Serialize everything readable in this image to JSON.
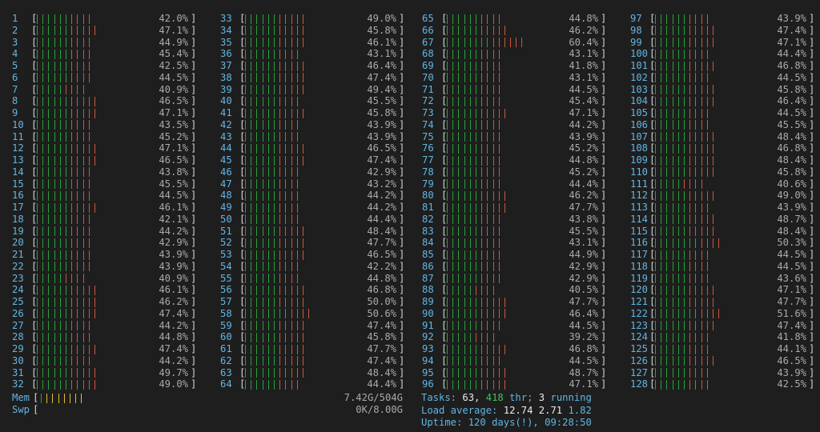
{
  "colors": {
    "background": "#1e1e1e",
    "label": "#61b5e3",
    "green": "#25a33c",
    "red": "#d2543b",
    "yellow": "#d9c236",
    "text": "#a9a9a9"
  },
  "cpus": [
    {
      "id": "1",
      "pct": "42.0%"
    },
    {
      "id": "2",
      "pct": "47.1%"
    },
    {
      "id": "3",
      "pct": "44.9%"
    },
    {
      "id": "4",
      "pct": "45.4%"
    },
    {
      "id": "5",
      "pct": "42.5%"
    },
    {
      "id": "6",
      "pct": "44.5%"
    },
    {
      "id": "7",
      "pct": "40.9%"
    },
    {
      "id": "8",
      "pct": "46.5%"
    },
    {
      "id": "9",
      "pct": "47.1%"
    },
    {
      "id": "10",
      "pct": "43.5%"
    },
    {
      "id": "11",
      "pct": "45.2%"
    },
    {
      "id": "12",
      "pct": "47.1%"
    },
    {
      "id": "13",
      "pct": "46.5%"
    },
    {
      "id": "14",
      "pct": "43.8%"
    },
    {
      "id": "15",
      "pct": "45.5%"
    },
    {
      "id": "16",
      "pct": "44.5%"
    },
    {
      "id": "17",
      "pct": "46.1%"
    },
    {
      "id": "18",
      "pct": "42.1%"
    },
    {
      "id": "19",
      "pct": "44.2%"
    },
    {
      "id": "20",
      "pct": "42.9%"
    },
    {
      "id": "21",
      "pct": "43.9%"
    },
    {
      "id": "22",
      "pct": "43.9%"
    },
    {
      "id": "23",
      "pct": "40.9%"
    },
    {
      "id": "24",
      "pct": "46.1%"
    },
    {
      "id": "25",
      "pct": "46.2%"
    },
    {
      "id": "26",
      "pct": "47.4%"
    },
    {
      "id": "27",
      "pct": "44.2%"
    },
    {
      "id": "28",
      "pct": "44.8%"
    },
    {
      "id": "29",
      "pct": "47.4%"
    },
    {
      "id": "30",
      "pct": "44.2%"
    },
    {
      "id": "31",
      "pct": "49.7%"
    },
    {
      "id": "32",
      "pct": "49.0%"
    },
    {
      "id": "33",
      "pct": "49.0%"
    },
    {
      "id": "34",
      "pct": "45.8%"
    },
    {
      "id": "35",
      "pct": "46.1%"
    },
    {
      "id": "36",
      "pct": "43.1%"
    },
    {
      "id": "37",
      "pct": "46.4%"
    },
    {
      "id": "38",
      "pct": "47.4%"
    },
    {
      "id": "39",
      "pct": "49.4%"
    },
    {
      "id": "40",
      "pct": "45.5%"
    },
    {
      "id": "41",
      "pct": "45.8%"
    },
    {
      "id": "42",
      "pct": "43.9%"
    },
    {
      "id": "43",
      "pct": "43.9%"
    },
    {
      "id": "44",
      "pct": "46.5%"
    },
    {
      "id": "45",
      "pct": "47.4%"
    },
    {
      "id": "46",
      "pct": "42.9%"
    },
    {
      "id": "47",
      "pct": "43.2%"
    },
    {
      "id": "48",
      "pct": "44.2%"
    },
    {
      "id": "49",
      "pct": "44.2%"
    },
    {
      "id": "50",
      "pct": "44.4%"
    },
    {
      "id": "51",
      "pct": "48.4%"
    },
    {
      "id": "52",
      "pct": "47.7%"
    },
    {
      "id": "53",
      "pct": "46.5%"
    },
    {
      "id": "54",
      "pct": "42.2%"
    },
    {
      "id": "55",
      "pct": "44.8%"
    },
    {
      "id": "56",
      "pct": "46.8%"
    },
    {
      "id": "57",
      "pct": "50.0%"
    },
    {
      "id": "58",
      "pct": "50.6%"
    },
    {
      "id": "59",
      "pct": "47.4%"
    },
    {
      "id": "60",
      "pct": "45.8%"
    },
    {
      "id": "61",
      "pct": "47.7%"
    },
    {
      "id": "62",
      "pct": "47.4%"
    },
    {
      "id": "63",
      "pct": "48.4%"
    },
    {
      "id": "64",
      "pct": "44.4%"
    },
    {
      "id": "65",
      "pct": "44.8%"
    },
    {
      "id": "66",
      "pct": "46.2%"
    },
    {
      "id": "67",
      "pct": "60.4%"
    },
    {
      "id": "68",
      "pct": "43.1%"
    },
    {
      "id": "69",
      "pct": "41.8%"
    },
    {
      "id": "70",
      "pct": "43.1%"
    },
    {
      "id": "71",
      "pct": "44.5%"
    },
    {
      "id": "72",
      "pct": "45.4%"
    },
    {
      "id": "73",
      "pct": "47.1%"
    },
    {
      "id": "74",
      "pct": "44.2%"
    },
    {
      "id": "75",
      "pct": "43.9%"
    },
    {
      "id": "76",
      "pct": "45.2%"
    },
    {
      "id": "77",
      "pct": "44.8%"
    },
    {
      "id": "78",
      "pct": "45.2%"
    },
    {
      "id": "79",
      "pct": "44.4%"
    },
    {
      "id": "80",
      "pct": "46.2%"
    },
    {
      "id": "81",
      "pct": "47.7%"
    },
    {
      "id": "82",
      "pct": "43.8%"
    },
    {
      "id": "83",
      "pct": "45.5%"
    },
    {
      "id": "84",
      "pct": "43.1%"
    },
    {
      "id": "85",
      "pct": "44.9%"
    },
    {
      "id": "86",
      "pct": "42.9%"
    },
    {
      "id": "87",
      "pct": "42.9%"
    },
    {
      "id": "88",
      "pct": "40.5%"
    },
    {
      "id": "89",
      "pct": "47.7%"
    },
    {
      "id": "90",
      "pct": "46.4%"
    },
    {
      "id": "91",
      "pct": "44.5%"
    },
    {
      "id": "92",
      "pct": "39.2%"
    },
    {
      "id": "93",
      "pct": "46.8%"
    },
    {
      "id": "94",
      "pct": "44.5%"
    },
    {
      "id": "95",
      "pct": "48.7%"
    },
    {
      "id": "96",
      "pct": "47.1%"
    },
    {
      "id": "97",
      "pct": "43.9%"
    },
    {
      "id": "98",
      "pct": "47.4%"
    },
    {
      "id": "99",
      "pct": "47.1%"
    },
    {
      "id": "100",
      "pct": "44.4%"
    },
    {
      "id": "101",
      "pct": "46.8%"
    },
    {
      "id": "102",
      "pct": "44.5%"
    },
    {
      "id": "103",
      "pct": "45.8%"
    },
    {
      "id": "104",
      "pct": "46.4%"
    },
    {
      "id": "105",
      "pct": "44.5%"
    },
    {
      "id": "106",
      "pct": "45.5%"
    },
    {
      "id": "107",
      "pct": "48.4%"
    },
    {
      "id": "108",
      "pct": "46.8%"
    },
    {
      "id": "109",
      "pct": "48.4%"
    },
    {
      "id": "110",
      "pct": "45.8%"
    },
    {
      "id": "111",
      "pct": "40.6%"
    },
    {
      "id": "112",
      "pct": "49.0%"
    },
    {
      "id": "113",
      "pct": "43.9%"
    },
    {
      "id": "114",
      "pct": "48.7%"
    },
    {
      "id": "115",
      "pct": "48.4%"
    },
    {
      "id": "116",
      "pct": "50.3%"
    },
    {
      "id": "117",
      "pct": "44.5%"
    },
    {
      "id": "118",
      "pct": "44.5%"
    },
    {
      "id": "119",
      "pct": "43.6%"
    },
    {
      "id": "120",
      "pct": "47.1%"
    },
    {
      "id": "121",
      "pct": "47.7%"
    },
    {
      "id": "122",
      "pct": "51.6%"
    },
    {
      "id": "123",
      "pct": "47.4%"
    },
    {
      "id": "124",
      "pct": "41.8%"
    },
    {
      "id": "125",
      "pct": "44.1%"
    },
    {
      "id": "126",
      "pct": "46.5%"
    },
    {
      "id": "127",
      "pct": "43.9%"
    },
    {
      "id": "128",
      "pct": "42.5%"
    }
  ],
  "mem": {
    "label": "Mem",
    "bracket": "[",
    "value": "7.42G/504G",
    "fill_pct": 1.5
  },
  "swp": {
    "label": "Swp",
    "bracket": "[",
    "value": "0K/8.00G",
    "fill_pct": 0
  },
  "tasks": {
    "label": "Tasks:",
    "count": "63,",
    "thr": "418",
    "thr_label": "thr;",
    "running": "3",
    "running_label": "running"
  },
  "load": {
    "label": "Load average:",
    "l1": "12.74",
    "l5": "2.71",
    "l15": "1.82"
  },
  "uptime": {
    "label": "Uptime:",
    "value": "120 days(!), 09:28:50"
  }
}
